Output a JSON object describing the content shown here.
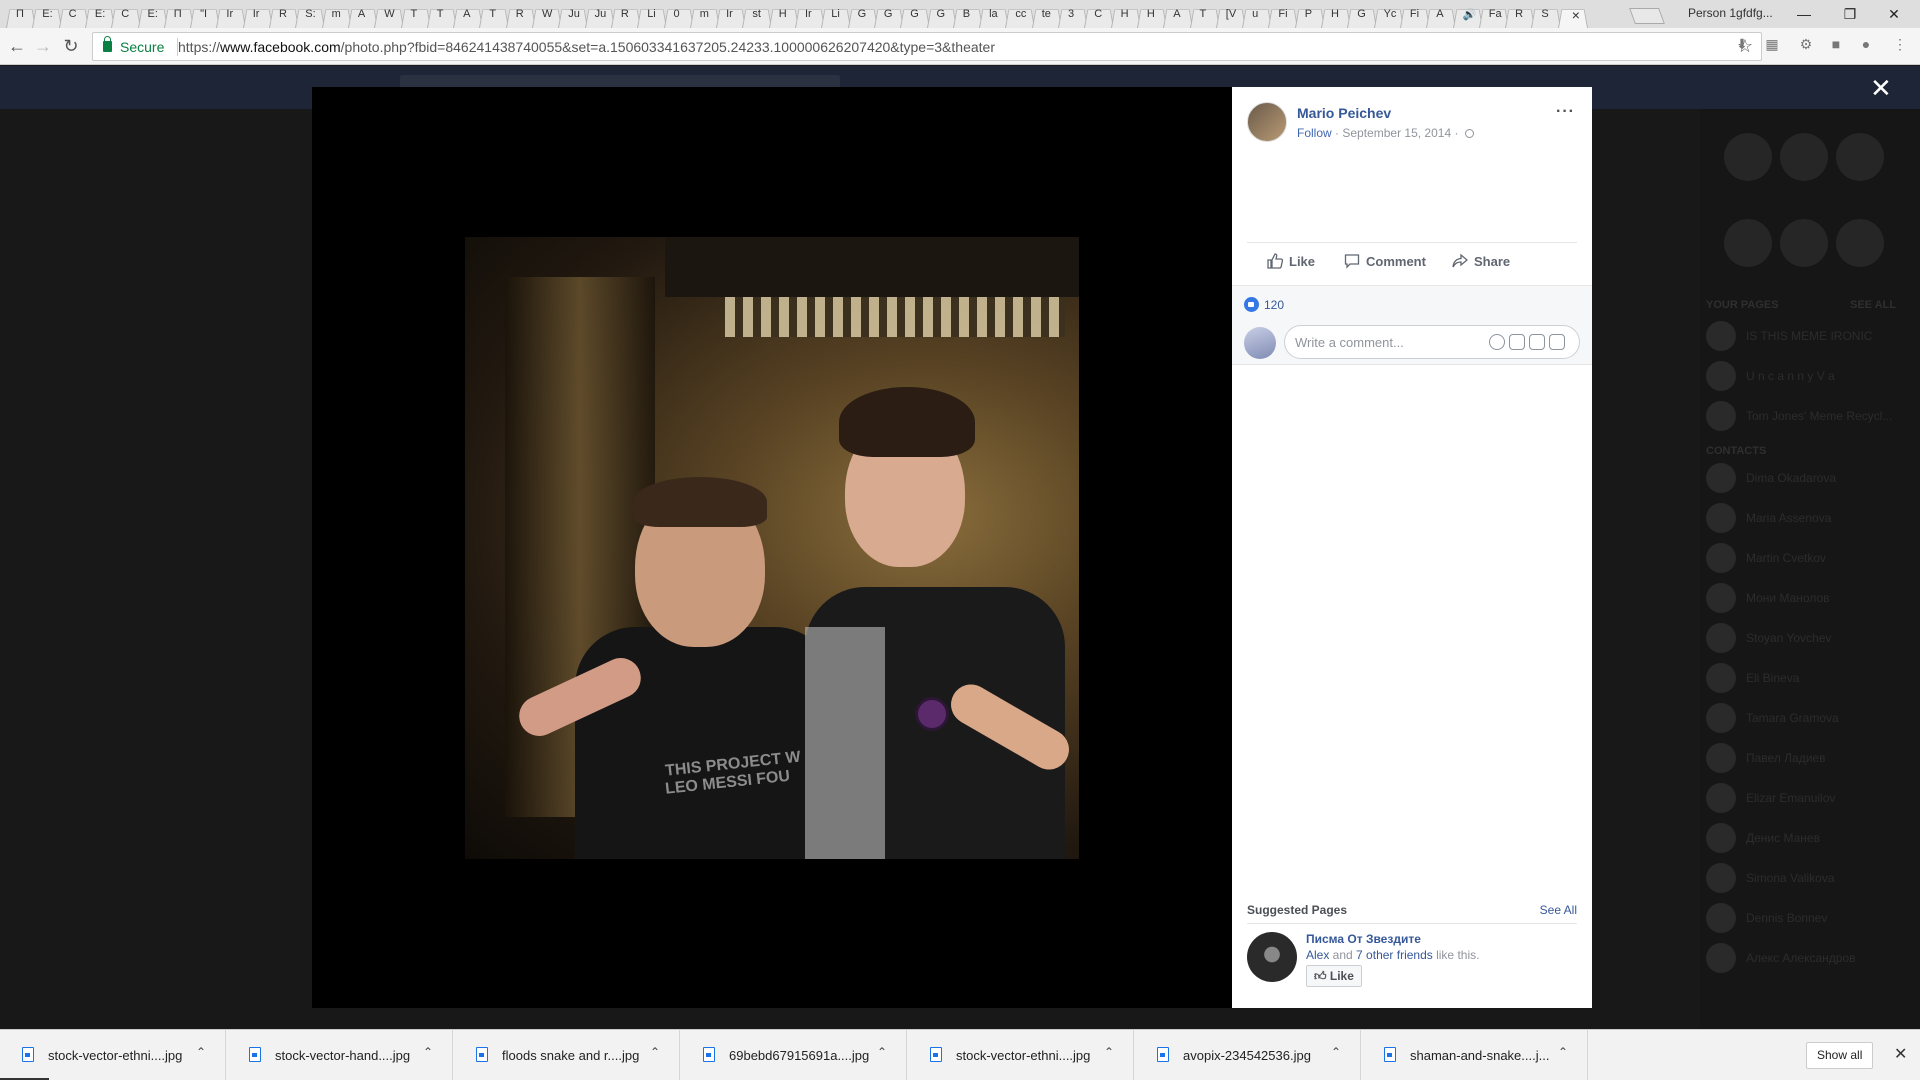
{
  "browser": {
    "tabs": [
      "П",
      "E:",
      "C",
      "E:",
      "C",
      "E:",
      "П",
      "\"I",
      "Ir",
      "Ir",
      "R",
      "S:",
      "m",
      "A",
      "W",
      "T",
      "T",
      "A",
      "T",
      "R",
      "W",
      "Ju",
      "Ju",
      "R",
      "Li",
      "0",
      "m",
      "Ir",
      "st",
      "H",
      "Ir",
      "Li",
      "G",
      "G",
      "G",
      "G",
      "B",
      "la",
      "cc",
      "te",
      "3",
      "C",
      "H",
      "H",
      "A",
      "T",
      "[V",
      "u",
      "Fi",
      "P",
      "H",
      "G",
      "Yc",
      "Fi",
      "A",
      "🔊",
      "Fa",
      "R",
      "S"
    ],
    "profile_name": "Person 1gfdfg...",
    "address": {
      "secure_label": "Secure",
      "scheme": "https://",
      "host": "www.facebook.com",
      "path": "/photo.php?fbid=846241438740055&set=a.150603341637205.24233.100000626207420&type=3&theater"
    }
  },
  "post": {
    "author": "Mario Peichev",
    "follow": "Follow",
    "date": "September 15, 2014",
    "actions": {
      "like": "Like",
      "comment": "Comment",
      "share": "Share"
    },
    "like_count": "120",
    "comment_placeholder": "Write a comment...",
    "photo_text": [
      "THIS PROJECT W",
      "LEO MESSI FOU"
    ]
  },
  "suggested": {
    "title": "Suggested Pages",
    "see_all": "See All",
    "page_name": "Писма От Звездите",
    "friend_name": "Alex",
    "and_text": " and ",
    "others": "7 other friends",
    "tail": " like this.",
    "like_button": "Like"
  },
  "background_sidebar": {
    "pages_header": "YOUR PAGES",
    "see_all": "SEE ALL",
    "pages": [
      "IS THIS MEME IRONIC",
      "U n c a n n y   V a",
      "Tom Jones' Meme Recycl..."
    ],
    "contacts_header": "CONTACTS",
    "contacts": [
      "Dima Okadarova",
      "Maria Assenova",
      "Martin Cvetkov",
      "Мони Манолов",
      "Stoyan Yovchev",
      "Eli Bineva",
      "Tamara Gramova",
      "Павел Ладиев",
      "Elizar Emanuilov",
      "Денис Манев",
      "Simona Valikova",
      "Dennis Bonnev",
      "Алекс Александров"
    ]
  },
  "downloads": {
    "items": [
      "stock-vector-ethni....jpg",
      "stock-vector-hand....jpg",
      "floods snake and r....jpg",
      "69bebd67915691a....jpg",
      "stock-vector-ethni....jpg",
      "avopix-234542536.jpg",
      "shaman-and-snake....j..."
    ],
    "show_all": "Show all"
  },
  "colors": {
    "fb_link": "#365899",
    "fb_blue": "#4267b2",
    "secure_green": "#0b8043"
  }
}
